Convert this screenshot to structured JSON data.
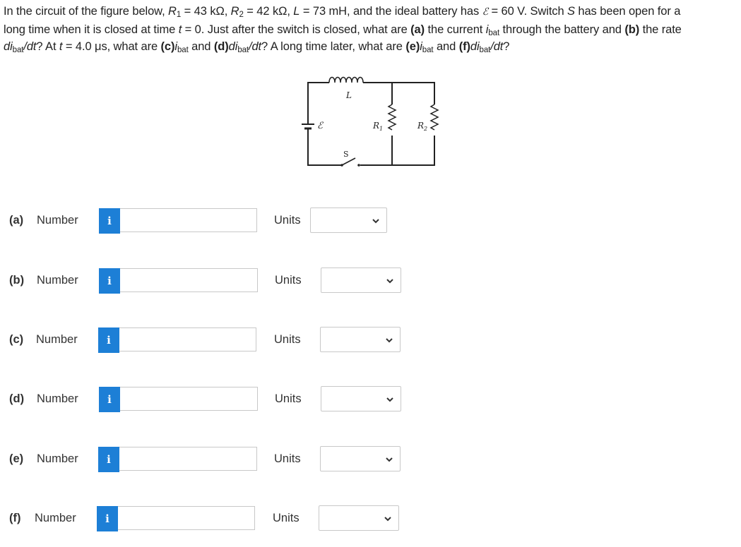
{
  "question": {
    "line1": {
      "intro": "In the circuit of the figure below, ",
      "R1_sym": "R",
      "R1_sub": "1",
      "R1_val": " = 43 kΩ, ",
      "R2_sym": "R",
      "R2_sub": "2",
      "R2_val": " = 42 kΩ, ",
      "L_sym": "L",
      "L_val": " = 73 mH, and the ideal battery has ",
      "emf_sym": "ℰ",
      "emf_val": " = 60 V. Switch ",
      "S_sym": "S",
      "tail": " has been open for a"
    },
    "line2": {
      "text1": "long time when it is closed at time ",
      "t_sym": "t",
      "text2": " = 0. Just after the switch is closed, what are ",
      "a": "(a)",
      "text3": " the current ",
      "i_sym": "i",
      "i_sub": "bat",
      "text4": " through the battery and ",
      "b": "(b)",
      "text5": " the rate"
    },
    "line3": {
      "di1": "di",
      "di1_sub": "bat",
      "dt1": "/dt",
      "text1": "? At ",
      "t_sym": "t",
      "text2": " = 4.0 μs, what are ",
      "c": "(c)",
      "i_sym": "i",
      "i_sub": "bat",
      "and1": " and ",
      "d": "(d)",
      "di2": "di",
      "di2_sub": "bat",
      "dt2": "/dt",
      "text3": "? A long time later, what are ",
      "e": "(e)",
      "i2_sym": "i",
      "i2_sub": "bat",
      "and2": " and ",
      "f": "(f)",
      "di3": "di",
      "di3_sub": "bat",
      "dt3": "/dt",
      "end": "?"
    }
  },
  "figure": {
    "inductor_label": "L",
    "emf_label": "ℰ",
    "switch_label": "S",
    "r1_label": "R",
    "r1_sub": "1",
    "r2_label": "R",
    "r2_sub": "2"
  },
  "answers": [
    {
      "part": "(a)",
      "number_label": "Number",
      "info": "i",
      "value": "",
      "units_label": "Units",
      "units_value": ""
    },
    {
      "part": "(b)",
      "number_label": "Number",
      "info": "i",
      "value": "",
      "units_label": "Units",
      "units_value": ""
    },
    {
      "part": "(c)",
      "number_label": "Number",
      "info": "i",
      "value": "",
      "units_label": "Units",
      "units_value": ""
    },
    {
      "part": "(d)",
      "number_label": "Number",
      "info": "i",
      "value": "",
      "units_label": "Units",
      "units_value": ""
    },
    {
      "part": "(e)",
      "number_label": "Number",
      "info": "i",
      "value": "",
      "units_label": "Units",
      "units_value": ""
    },
    {
      "part": "(f)",
      "number_label": "Number",
      "info": "i",
      "value": "",
      "units_label": "Units",
      "units_value": ""
    }
  ],
  "colors": {
    "info_button": "#1d7fd6",
    "border": "#c8c8c8",
    "text": "#222222"
  }
}
